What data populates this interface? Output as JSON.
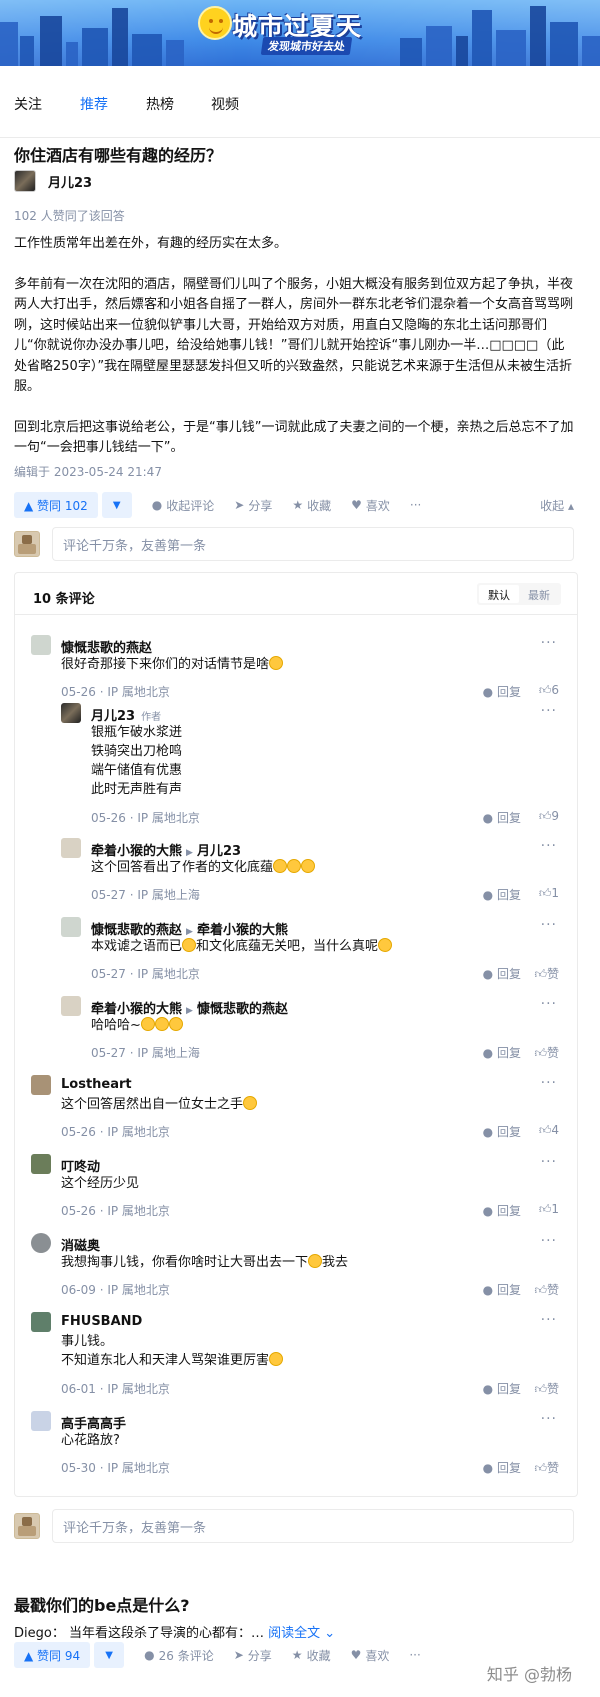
{
  "banner": {
    "title": "城市过夏天",
    "subtitle": "发现城市好去处"
  },
  "tabs": [
    {
      "label": "关注",
      "active": false
    },
    {
      "label": "推荐",
      "active": true
    },
    {
      "label": "热榜",
      "active": false
    },
    {
      "label": "视频",
      "active": false
    }
  ],
  "answer": {
    "question": "你住酒店有哪些有趣的经历？",
    "author": "月儿23",
    "votes_line": "102 人赞同了该回答",
    "paragraphs": [
      "工作性质常年出差在外，有趣的经历实在太多。",
      "多年前有一次在沈阳的酒店，隔壁哥们儿叫了个服务，小姐大概没有服务到位双方起了争执，半夜两人大打出手，然后嫖客和小姐各自摇了一群人，房间外一群东北老爷们混杂着一个女高音骂骂咧咧，这时候站出来一位貌似铲事儿大哥，开始给双方对质，用直白又隐晦的东北土话问那哥们儿“你就说你办没办事儿吧，给没给她事儿钱！”哥们儿就开始控诉“事儿刚办一半…□□□□（此处省略250字）”我在隔壁屋里瑟瑟发抖但又听的兴致盎然，只能说艺术来源于生活但从未被生活折服。",
      "回到北京后把这事说给老公，于是“事儿钱”一词就此成了夫妻之间的一个梗，亲热之后总忘不了加一句“一会把事儿钱结一下”。"
    ],
    "edited": "编辑于 2023-05-24 21:47",
    "vote_label": "▲ 赞同 102",
    "actions": {
      "collapse_comments": "收起评论",
      "share": "分享",
      "favorite": "收藏",
      "like": "喜欢",
      "more": "···",
      "collapse": "收起"
    }
  },
  "comment_input": {
    "placeholder": "评论千万条，友善第一条"
  },
  "comments": {
    "count": "10 条评论",
    "sort": [
      "默认",
      "最新"
    ],
    "reply_label": "回复",
    "items": [
      {
        "name": "慷慨悲歌的燕赵",
        "text": [
          "很好奇那接下来你们的对话情节是啥"
        ],
        "date": "05-26",
        "ip": "IP 属地北京",
        "likes": "6",
        "avatar": "#cfd6cf"
      },
      {
        "name": "月儿23",
        "tag": "作者",
        "text": [
          "银瓶乍破水浆迸",
          "铁骑突出刀枪鸣",
          "端午储值有优惠",
          "此时无声胜有声"
        ],
        "date": "05-26",
        "ip": "IP 属地北京",
        "likes": "9",
        "avatar": "#3a3a3a"
      },
      {
        "name": "牵着小猴的大熊",
        "to": "月儿23",
        "text": [
          "这个回答看出了作者的文化底蕴"
        ],
        "date": "05-27",
        "ip": "IP 属地上海",
        "likes": "1",
        "avatar": "#d9d2c4"
      },
      {
        "name": "慷慨悲歌的燕赵",
        "to": "牵着小猴的大熊",
        "text": [
          "本戏谑之语而已",
          "和文化底蕴无关吧，当什么真呢"
        ],
        "date": "05-27",
        "ip": "IP 属地北京",
        "likes": "赞",
        "avatar": "#cfd6cf"
      },
      {
        "name": "牵着小猴的大熊",
        "to": "慷慨悲歌的燕赵",
        "text": [
          "哈哈哈~"
        ],
        "date": "05-27",
        "ip": "IP 属地上海",
        "likes": "赞",
        "avatar": "#d9d2c4"
      },
      {
        "name": "Lostheart",
        "text": [
          "这个回答居然出自一位女士之手"
        ],
        "date": "05-26",
        "ip": "IP 属地北京",
        "likes": "4",
        "avatar": "#a89276"
      },
      {
        "name": "叮咚动",
        "text": [
          "这个经历少见"
        ],
        "date": "05-26",
        "ip": "IP 属地北京",
        "likes": "1",
        "avatar": "#6b7d5a"
      },
      {
        "name": "消磁奥",
        "text": [
          "我想掏事儿钱，你看你啥时让大哥出去一下",
          "我去"
        ],
        "date": "06-09",
        "ip": "IP 属地北京",
        "likes": "赞",
        "avatar": "#8a8f93"
      },
      {
        "name": "FHUSBAND",
        "text": [
          "事儿钱。",
          "不知道东北人和天津人骂架谁更厉害"
        ],
        "date": "06-01",
        "ip": "IP 属地北京",
        "likes": "赞",
        "avatar": "#5f7f6a"
      },
      {
        "name": "高手高高手",
        "text": [
          "心花路放?"
        ],
        "date": "05-30",
        "ip": "IP 属地北京",
        "likes": "赞",
        "avatar": "#c9d3e6"
      }
    ]
  },
  "answer2": {
    "question": "最戳你们的be点是什么?",
    "author": "Diego：",
    "excerpt": "当年看这段杀了导演的心都有：…",
    "read_more": "阅读全文 ⌄",
    "vote_label": "▲ 赞同 94",
    "comments": "26 条评论",
    "share": "分享",
    "favorite": "收藏",
    "like": "喜欢",
    "more": "···"
  },
  "watermark": "知乎 @勃杨"
}
